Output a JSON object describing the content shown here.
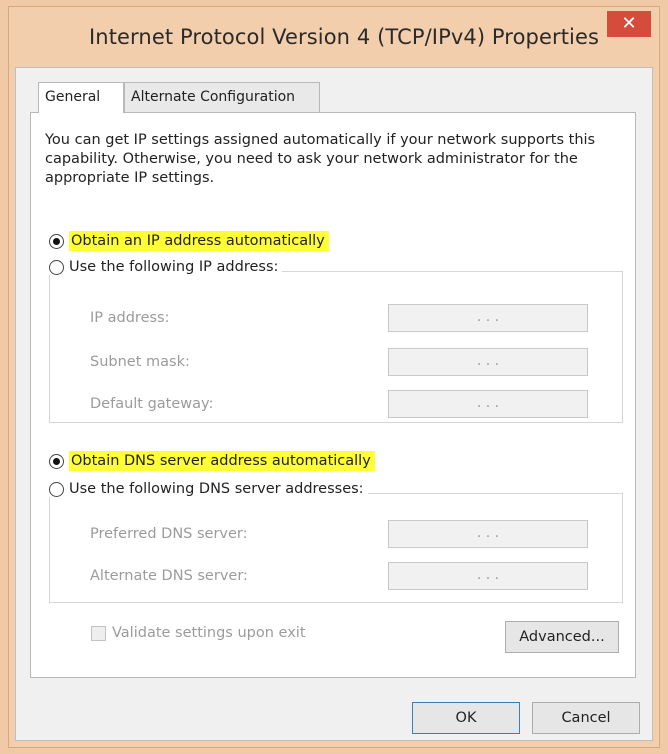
{
  "window": {
    "title": "Internet Protocol Version 4 (TCP/IPv4) Properties",
    "close_glyph": "✕"
  },
  "tabs": [
    {
      "label": "General",
      "active": true
    },
    {
      "label": "Alternate Configuration",
      "active": false
    }
  ],
  "description": "You can get IP settings assigned automatically if your network supports this capability. Otherwise, you need to ask your network administrator for the appropriate IP settings.",
  "ip_section": {
    "auto_label": "Obtain an IP address automatically",
    "auto_selected": true,
    "manual_label": "Use the following IP address:",
    "manual_selected": false,
    "fields": [
      {
        "label": "IP address:",
        "value": ".   .   ."
      },
      {
        "label": "Subnet mask:",
        "value": ".   .   ."
      },
      {
        "label": "Default gateway:",
        "value": ".   .   ."
      }
    ]
  },
  "dns_section": {
    "auto_label": "Obtain DNS server address automatically",
    "auto_selected": true,
    "manual_label": "Use the following DNS server addresses:",
    "manual_selected": false,
    "fields": [
      {
        "label": "Preferred DNS server:",
        "value": ".   .   ."
      },
      {
        "label": "Alternate DNS server:",
        "value": ".   .   ."
      }
    ]
  },
  "validate": {
    "label": "Validate settings upon exit",
    "checked": false,
    "enabled": false
  },
  "buttons": {
    "advanced": "Advanced...",
    "ok": "OK",
    "cancel": "Cancel"
  },
  "colors": {
    "highlight": "#ffff33",
    "close_button": "#d64c3c",
    "window_frame": "#f3ceac"
  }
}
